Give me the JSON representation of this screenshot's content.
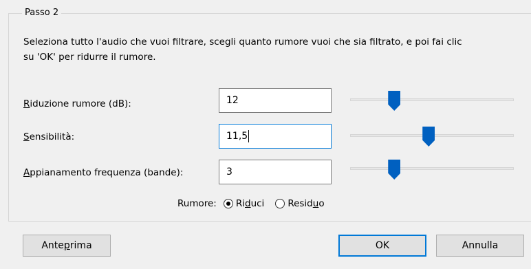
{
  "group": {
    "title": "Passo 2"
  },
  "instructions": "Seleziona tutto l'audio che vuoi filtrare, scegli quanto rumore vuoi che sia filtrato, e poi fai clic su 'OK' per ridurre il rumore.",
  "rows": [
    {
      "label_accel": "R",
      "label_rest": "iduzione rumore (dB):",
      "value": "12",
      "slider_level": 0.27
    },
    {
      "label_accel": "S",
      "label_rest": "ensibilità:",
      "value": "11,5",
      "slider_level": 0.48
    },
    {
      "label_accel": "A",
      "label_rest": "ppianamento frequenza (bande):",
      "value": "3",
      "slider_level": 0.27
    }
  ],
  "noise": {
    "label": "Rumore:",
    "options": [
      {
        "pre": "Ri",
        "accel": "d",
        "post": "uci",
        "checked": true
      },
      {
        "pre": "Resid",
        "accel": "u",
        "post": "o",
        "checked": false
      }
    ]
  },
  "buttons": {
    "preview": {
      "pre": "Ante",
      "accel": "p",
      "post": "rima"
    },
    "ok": "OK",
    "cancel": "Annulla"
  }
}
